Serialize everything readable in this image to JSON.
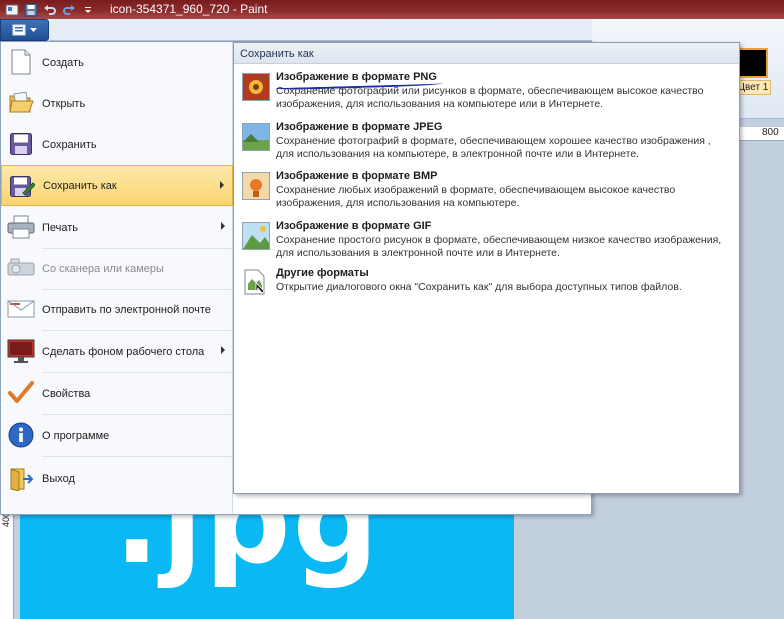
{
  "window": {
    "title": "icon-354371_960_720 - Paint"
  },
  "ribbon": {
    "color_label": "Цвет 1",
    "ruler_top_mark": "800",
    "ruler_left_mark": "400",
    "canvas_text": ".jpg"
  },
  "app_menu": {
    "items": [
      {
        "label": "Создать",
        "icon": "new-document-icon"
      },
      {
        "label": "Открыть",
        "icon": "open-folder-icon"
      },
      {
        "label": "Сохранить",
        "icon": "save-disk-icon"
      },
      {
        "label": "Сохранить как",
        "icon": "save-as-icon",
        "submenu": true,
        "selected": true
      },
      {
        "label": "Печать",
        "icon": "printer-icon",
        "submenu": true
      },
      {
        "label": "Со сканера или камеры",
        "icon": "scanner-icon",
        "disabled": true
      },
      {
        "label": "Отправить по электронной почте",
        "icon": "email-icon"
      },
      {
        "label": "Сделать фоном рабочего стола",
        "icon": "desktop-background-icon",
        "submenu": true
      },
      {
        "label": "Свойства",
        "icon": "properties-check-icon"
      },
      {
        "label": "О программе",
        "icon": "info-icon"
      },
      {
        "label": "Выход",
        "icon": "exit-icon"
      }
    ]
  },
  "submenu": {
    "header": "Сохранить как",
    "items": [
      {
        "title": "Изображение в формате PNG",
        "description": "Сохранение фотографий или рисунков в формате, обеспечивающем высокое качество изображения, для использования на компьютере или в Интернете.",
        "icon": "png-image-icon"
      },
      {
        "title": "Изображение в формате JPEG",
        "description": "Сохранение фотографий в формате, обеспечивающем хорошее качество изображения , для использования на компьютере, в электронной почте или в Интернете.",
        "icon": "jpeg-image-icon"
      },
      {
        "title": "Изображение в формате BMP",
        "description": "Сохранение любых изображений в формате, обеспечивающем высокое качество изображения, для использования на компьютере.",
        "icon": "bmp-image-icon"
      },
      {
        "title": "Изображение в формате GIF",
        "description": "Сохранение простого рисунок в формате, обеспечивающем низкое качество изображения, для использования в электронной почте или в Интернете.",
        "icon": "gif-image-icon"
      },
      {
        "title": "Другие форматы",
        "description": "Открытие диалогового окна \"Сохранить как\" для выбора доступных типов файлов.",
        "icon": "other-formats-icon"
      }
    ]
  },
  "colors": {
    "title_bar": "#8c2a2a",
    "selected_item": "#fbd46f",
    "canvas_image": "#0ab8f3",
    "annotation_underline": "#1a2fa8"
  }
}
